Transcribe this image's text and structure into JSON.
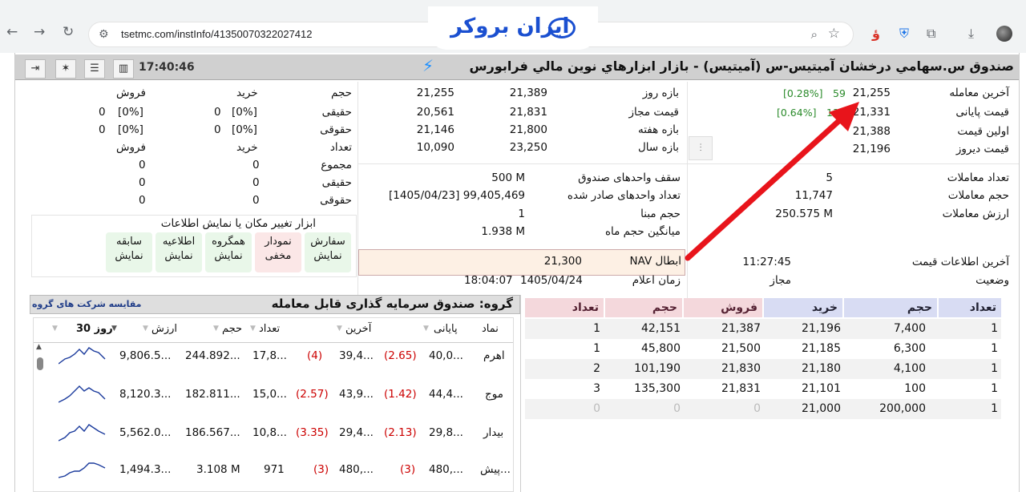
{
  "browser": {
    "url": "tsetmc.com/instInfo/41350070322027412",
    "logo_text": "ایران بروکر"
  },
  "header": {
    "title": "صندوق س.سهامي درخشان آميتيس-س (آميتيس) - بازار ابزارهاي نوين مالي فرابورس",
    "time": "17:40:46"
  },
  "price_info": {
    "last_trade_label": "آخرین معامله",
    "last_trade_value": "21,255",
    "last_trade_change": "59",
    "last_trade_pct": "[0.28%]",
    "close_price_label": "قیمت پایانی",
    "close_price_value": "21,331",
    "close_price_change": "13",
    "close_price_pct": "[0.64%]",
    "first_price_label": "اولین قیمت",
    "first_price_value": "21,388",
    "yesterday_price_label": "قیمت دیروز",
    "yesterday_price_value": "21,196"
  },
  "ranges": {
    "day_label": "بازه روز",
    "day_low": "21,255",
    "day_high": "21,389",
    "allowed_label": "قیمت مجاز",
    "allowed_low": "20,561",
    "allowed_high": "21,831",
    "week_label": "بازه هفته",
    "week_low": "21,146",
    "week_high": "21,800",
    "year_label": "بازه سال",
    "year_low": "10,090",
    "year_high": "23,250"
  },
  "trades": {
    "count_label": "تعداد معاملات",
    "count_value": "5",
    "volume_label": "حجم معاملات",
    "volume_value": "11,747",
    "value_label": "ارزش معاملات",
    "value_value": "250.575 M",
    "last_info_label": "آخرین اطلاعات قیمت",
    "last_info_value": "11:27:45",
    "status_label": "وضعیت",
    "status_value": "مجاز"
  },
  "fund": {
    "cap_label": "سقف واحدهای صندوق",
    "cap_value": "500 M",
    "issued_label": "تعداد واحدهای صادر شده",
    "issued_value": "99,405,469",
    "issued_date": "[1405/04/23]",
    "base_vol_label": "حجم مبنا",
    "base_vol_value": "1",
    "avg_vol_label": "میانگین حجم ماه",
    "avg_vol_value": "1.938 M",
    "nav_label": "NAV ابطال",
    "nav_value": "21,300",
    "announce_label": "زمان اعلام",
    "announce_date": "1405/04/24",
    "announce_time": "18:04:07"
  },
  "client_types": {
    "h_volume": "حجم",
    "h_buy": "خرید",
    "h_sell": "فروش",
    "real_label": "حقیقی",
    "legal_label": "حقوقی",
    "count_label": "تعداد",
    "total_label": "مجموع",
    "real_buy_pct": "[0%]",
    "real_buy": "0",
    "real_sell_pct": "[0%]",
    "real_sell": "0",
    "legal_buy_pct": "[0%]",
    "legal_buy": "0",
    "legal_sell_pct": "[0%]",
    "legal_sell": "0",
    "total_buy": "0",
    "total_sell": "0",
    "cnt_real_buy": "0",
    "cnt_real_sell": "0",
    "cnt_legal_buy": "0",
    "cnt_legal_sell": "0"
  },
  "tools": {
    "title": "ابزار تغییر مکان یا نمایش اطلاعات",
    "buttons": [
      {
        "name": "سفارش",
        "state": "نمایش"
      },
      {
        "name": "نمودار",
        "state": "مخفی"
      },
      {
        "name": "همگروه",
        "state": "نمایش"
      },
      {
        "name": "اطلاعیه",
        "state": "نمایش"
      },
      {
        "name": "سابقه",
        "state": "نمایش"
      }
    ]
  },
  "group": {
    "title": "گروه: صندوق سرمایه گذاری قابل معامله",
    "compare_link": "مقایسه شرکت های گروه",
    "columns": [
      "نماد",
      "پایانی",
      "آخرین",
      "تعداد",
      "حجم",
      "ارزش",
      "30 روز"
    ],
    "sort_marker": "▼",
    "rows": [
      {
        "symbol": "اهرم",
        "close": "40,0...",
        "close_chg": "(2.65)",
        "last": "39,4...",
        "last_chg": "(4)",
        "count": "17,8...",
        "volume": "244.892...",
        "value": "9,806.5..."
      },
      {
        "symbol": "موج",
        "close": "44,4...",
        "close_chg": "(1.42)",
        "last": "43,9...",
        "last_chg": "(2.57)",
        "count": "15,0...",
        "volume": "182.811...",
        "value": "8,120.3..."
      },
      {
        "symbol": "بیدار",
        "close": "29,8...",
        "close_chg": "(2.13)",
        "last": "29,4...",
        "last_chg": "(3.35)",
        "count": "10,8...",
        "volume": "186.567...",
        "value": "5,562.0..."
      },
      {
        "symbol": "پیش...",
        "close": "480,...",
        "close_chg": "(3)",
        "last": "480,...",
        "last_chg": "(3)",
        "count": "971",
        "volume": "3.108 M",
        "value": "1,494.3..."
      }
    ]
  },
  "order_book": {
    "h_count_buy": "تعداد",
    "h_volume_buy": "حجم",
    "h_price_buy": "خرید",
    "h_price_sell": "فروش",
    "h_volume_sell": "حجم",
    "h_count_sell": "تعداد",
    "rows": [
      {
        "buy_count": "1",
        "buy_volume": "7,400",
        "buy_price": "21,196",
        "sell_price": "21,387",
        "sell_volume": "42,151",
        "sell_count": "1"
      },
      {
        "buy_count": "1",
        "buy_volume": "6,300",
        "buy_price": "21,185",
        "sell_price": "21,500",
        "sell_volume": "45,800",
        "sell_count": "1"
      },
      {
        "buy_count": "1",
        "buy_volume": "4,100",
        "buy_price": "21,180",
        "sell_price": "21,830",
        "sell_volume": "101,190",
        "sell_count": "2"
      },
      {
        "buy_count": "1",
        "buy_volume": "100",
        "buy_price": "21,101",
        "sell_price": "21,831",
        "sell_volume": "135,300",
        "sell_count": "3"
      },
      {
        "buy_count": "1",
        "buy_volume": "200,000",
        "buy_price": "21,000",
        "sell_price": "0",
        "sell_volume": "0",
        "sell_count": "0"
      }
    ]
  },
  "colors": {
    "positive": "#2a8a2a",
    "negative": "#c00000",
    "buy_header": "#d8dcf3",
    "sell_header": "#f4d8dc",
    "arrow": "#e8141b"
  }
}
